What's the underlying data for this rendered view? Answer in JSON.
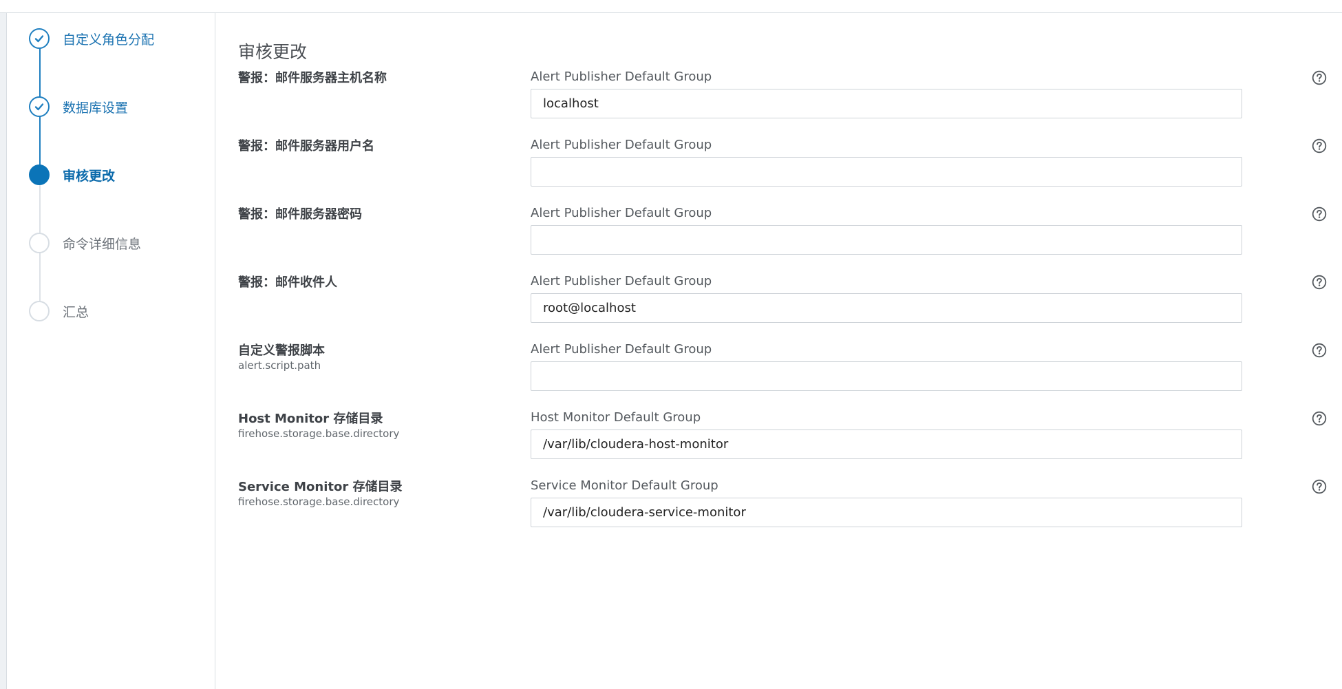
{
  "wizard": {
    "steps": [
      {
        "label": "自定义角色分配",
        "status": "done"
      },
      {
        "label": "数据库设置",
        "status": "done"
      },
      {
        "label": "审核更改",
        "status": "active"
      },
      {
        "label": "命令详细信息",
        "status": "pending"
      },
      {
        "label": "汇总",
        "status": "pending"
      }
    ]
  },
  "main": {
    "title": "审核更改",
    "properties": [
      {
        "name": "警报：邮件服务器主机名称",
        "key": "",
        "group": "Alert Publisher Default Group",
        "value": "localhost"
      },
      {
        "name": "警报：邮件服务器用户名",
        "key": "",
        "group": "Alert Publisher Default Group",
        "value": ""
      },
      {
        "name": "警报：邮件服务器密码",
        "key": "",
        "group": "Alert Publisher Default Group",
        "value": ""
      },
      {
        "name": "警报：邮件收件人",
        "key": "",
        "group": "Alert Publisher Default Group",
        "value": "root@localhost"
      },
      {
        "name": "自定义警报脚本",
        "key": "alert.script.path",
        "group": "Alert Publisher Default Group",
        "value": ""
      },
      {
        "name": "Host Monitor 存储目录",
        "key": "firehose.storage.base.directory",
        "group": "Host Monitor Default Group",
        "value": "/var/lib/cloudera-host-monitor"
      },
      {
        "name": "Service Monitor 存储目录",
        "key": "firehose.storage.base.directory",
        "group": "Service Monitor Default Group",
        "value": "/var/lib/cloudera-service-monitor"
      }
    ]
  },
  "colors": {
    "accent": "#0b74b8",
    "done": "#1f7fc0",
    "pending": "#d7dde3"
  }
}
